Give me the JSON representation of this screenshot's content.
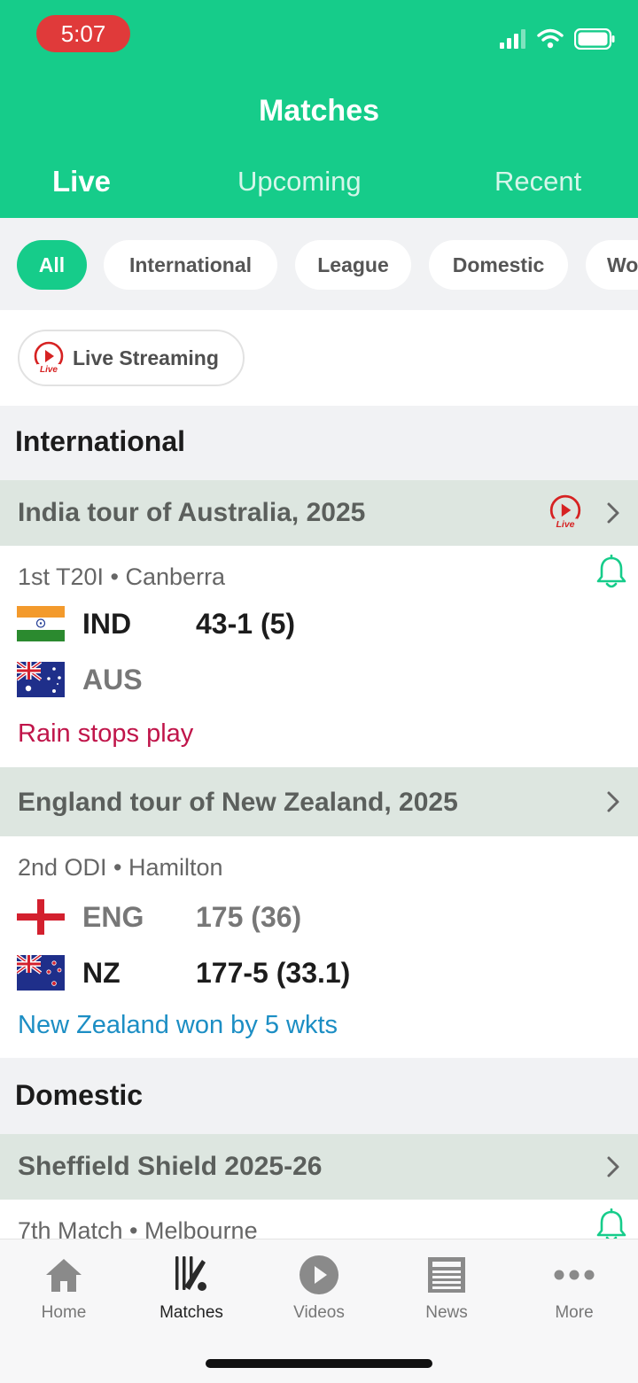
{
  "status_bar": {
    "time": "5:07"
  },
  "header": {
    "title": "Matches",
    "tabs": [
      {
        "label": "Live",
        "active": true
      },
      {
        "label": "Upcoming",
        "active": false
      },
      {
        "label": "Recent",
        "active": false
      }
    ]
  },
  "filters": {
    "chips": [
      "All",
      "International",
      "League",
      "Domestic",
      "Wo"
    ],
    "selected": "All"
  },
  "live_streaming": {
    "label": "Live Streaming",
    "badge": "Live"
  },
  "sections": [
    {
      "title": "International",
      "series": [
        {
          "title": "India tour of Australia, 2025",
          "live_badge": "Live",
          "match": {
            "meta": "1st T20I • Canberra",
            "teams": [
              {
                "code": "IND",
                "score": "43-1 (5)"
              },
              {
                "code": "AUS",
                "score": ""
              }
            ],
            "status": "Rain stops play"
          }
        },
        {
          "title": "England tour of New Zealand, 2025",
          "match": {
            "meta": "2nd ODI • Hamilton",
            "teams": [
              {
                "code": "ENG",
                "score": "175 (36)"
              },
              {
                "code": "NZ",
                "score": "177-5 (33.1)"
              }
            ],
            "status": "New Zealand won by 5 wkts"
          }
        }
      ]
    },
    {
      "title": "Domestic",
      "series": [
        {
          "title": "Sheffield Shield 2025-26",
          "match": {
            "meta": "7th Match • Melbourne"
          }
        }
      ]
    }
  ],
  "bottom_nav": [
    {
      "label": "Home",
      "icon": "home-icon"
    },
    {
      "label": "Matches",
      "icon": "cricket-icon",
      "active": true
    },
    {
      "label": "Videos",
      "icon": "play-icon"
    },
    {
      "label": "News",
      "icon": "newspaper-icon"
    },
    {
      "label": "More",
      "icon": "more-icon"
    }
  ],
  "colors": {
    "brand_green": "#16cc8a",
    "status_red": "#c0154a",
    "status_blue": "#1c8ec4",
    "time_pill": "#e03a3a"
  }
}
